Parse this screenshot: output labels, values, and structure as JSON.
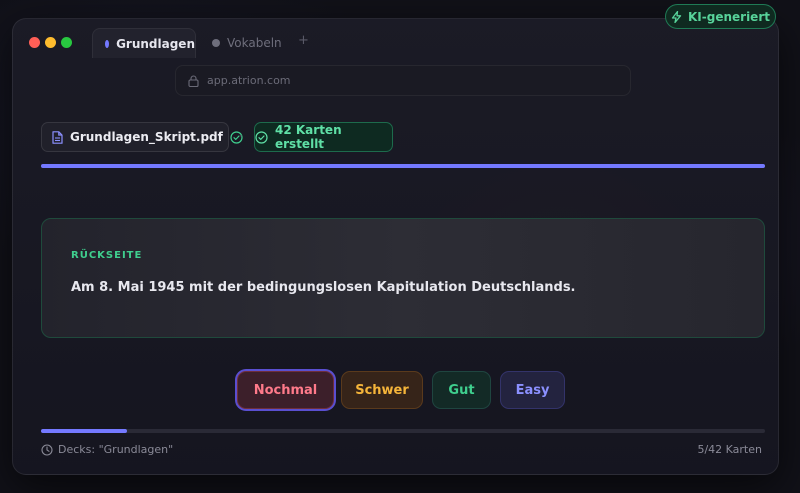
{
  "badge": {
    "label": "KI-generiert",
    "icon": "lightning-icon",
    "color": "#57d39a"
  },
  "window_controls": {
    "close": "#ff5f57",
    "minimize": "#febc2e",
    "maximize": "#28c840"
  },
  "tabs": [
    {
      "label": "Grundlagen",
      "active": true,
      "dot_color": "#7479ff"
    },
    {
      "label": "Vokabeln",
      "active": false,
      "dot_color": "#6e6e7c"
    }
  ],
  "tab_add": "+",
  "address_bar": {
    "url": "app.atrion.com",
    "icon": "lock-icon"
  },
  "file": {
    "name": "Grundlagen_Skript.pdf",
    "icon": "document-icon",
    "status_icon": "check-circle-icon"
  },
  "separator": "·",
  "generated": {
    "label": "42 Karten erstellt",
    "icon": "check-circle-icon"
  },
  "upload_progress": 1.0,
  "card": {
    "side_label": "RÜCKSEITE",
    "answer": "Am 8. Mai 1945 mit der bedingungslosen Kapitulation Deutschlands."
  },
  "ratings": [
    {
      "label": "Nochmal",
      "color": "#ff7a8a"
    },
    {
      "label": "Schwer",
      "color": "#f5b53a"
    },
    {
      "label": "Gut",
      "color": "#3fcf8e"
    },
    {
      "label": "Easy",
      "color": "#8b90ff"
    }
  ],
  "review_progress": 0.119,
  "footer": {
    "deck": "Decks: \"Grundlagen\"",
    "deck_icon": "clock-icon",
    "count": "5/42 Karten"
  },
  "accent": "#7479ff"
}
